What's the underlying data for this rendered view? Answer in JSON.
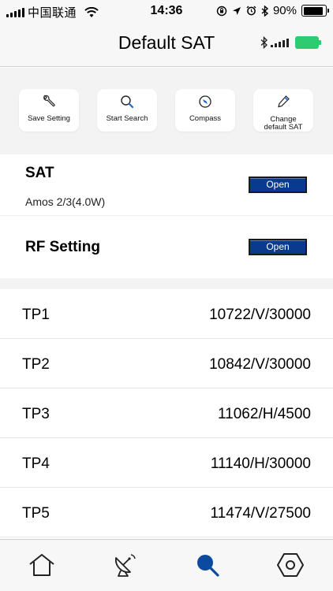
{
  "status_bar": {
    "carrier": "中国联通",
    "time": "14:36",
    "battery_percent": "90%",
    "battery_level": 0.9
  },
  "header": {
    "title": "Default SAT",
    "device_battery_color": "#2ecc71"
  },
  "actions": [
    {
      "label": "Save Setting",
      "icon": "wrench-icon"
    },
    {
      "label": "Start Search",
      "icon": "search-icon"
    },
    {
      "label": "Compass",
      "icon": "compass-icon"
    },
    {
      "label_line1": "Change",
      "label_line2": "default SAT",
      "icon": "pen-icon"
    }
  ],
  "sat_section": {
    "title": "SAT",
    "satellite": "Amos 2/3(4.0W)",
    "open_label": "Open"
  },
  "rf_section": {
    "title": "RF Setting",
    "open_label": "Open"
  },
  "tp_list": [
    {
      "name": "TP1",
      "value": "10722/V/30000"
    },
    {
      "name": "TP2",
      "value": "10842/V/30000"
    },
    {
      "name": "TP3",
      "value": "11062/H/4500"
    },
    {
      "name": "TP4",
      "value": "11140/H/30000"
    },
    {
      "name": "TP5",
      "value": "11474/V/27500"
    }
  ],
  "tabs": [
    {
      "icon": "home-icon",
      "active": false
    },
    {
      "icon": "satellite-dish-icon",
      "active": false
    },
    {
      "icon": "search-icon",
      "active": true
    },
    {
      "icon": "hexagon-settings-icon",
      "active": false
    }
  ],
  "colors": {
    "accent": "#0a3a8e",
    "active_tab": "#0b4a9e"
  }
}
